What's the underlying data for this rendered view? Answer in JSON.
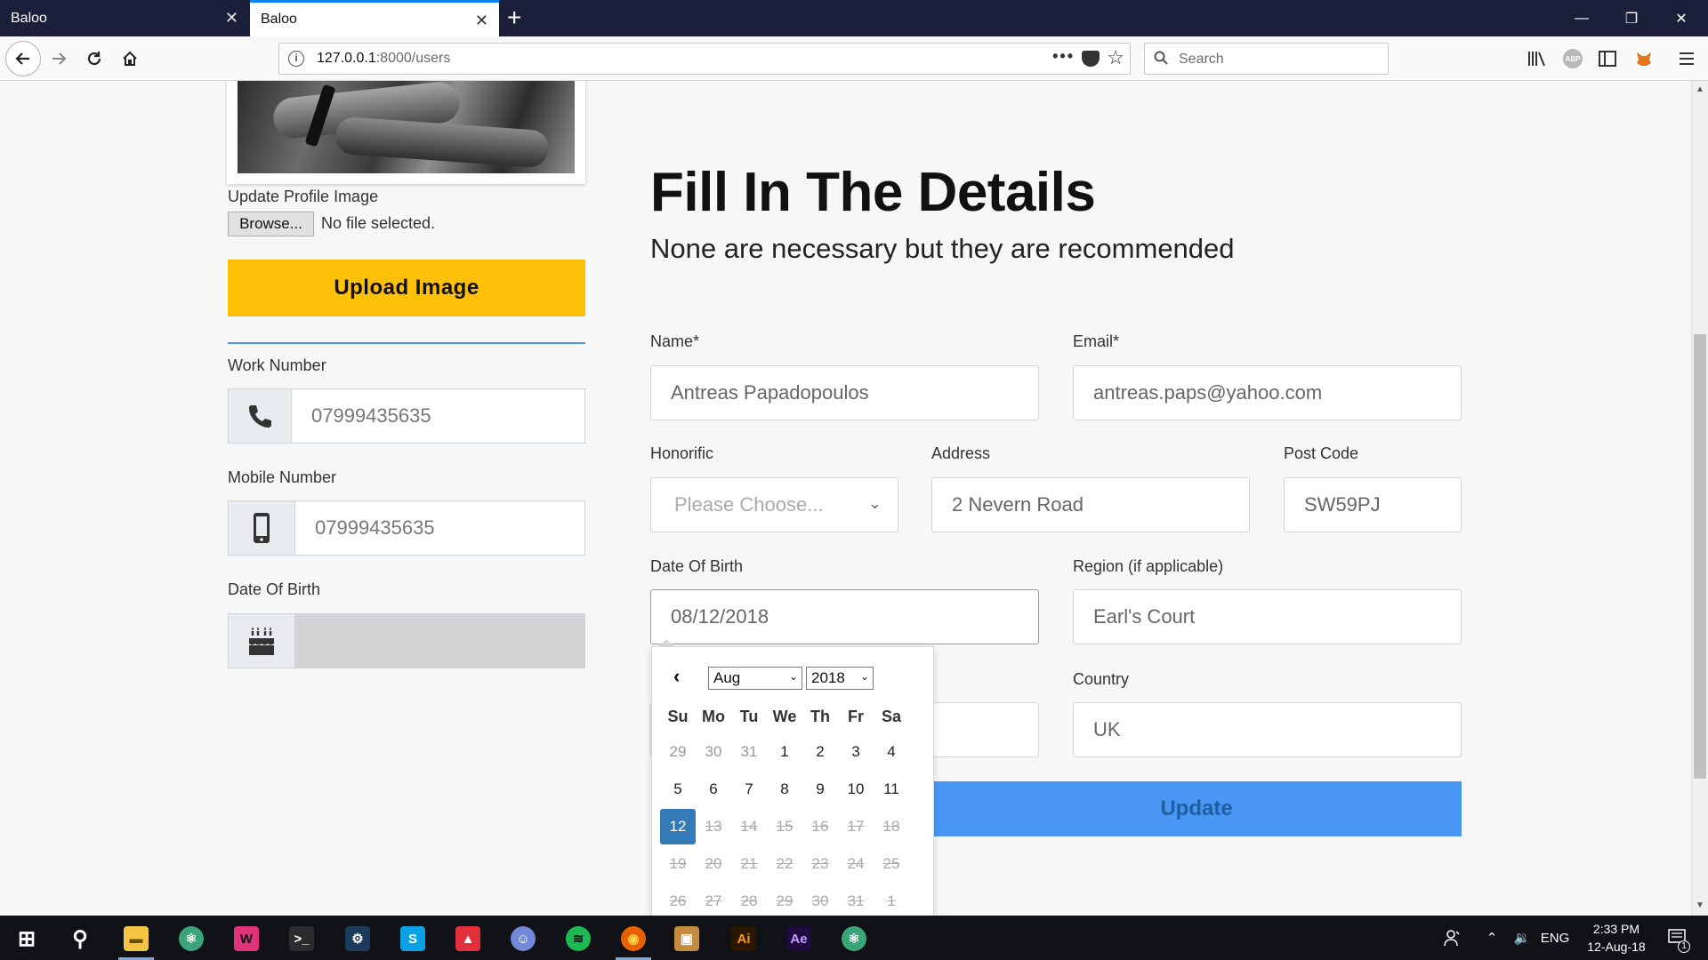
{
  "browser": {
    "tabs": [
      {
        "title": "Baloo",
        "active": false
      },
      {
        "title": "Baloo",
        "active": true
      }
    ],
    "new_tab_glyph": "+",
    "url_host": "127.0.0.1",
    "url_path": ":8000/users",
    "search_placeholder": "Search",
    "page_actions_glyph": "•••",
    "window_controls": [
      "—",
      "❐",
      "✕"
    ]
  },
  "sidebar": {
    "update_profile_label": "Update Profile Image",
    "browse_label": "Browse...",
    "file_status": "No file selected.",
    "upload_label": "Upload Image",
    "work_number_label": "Work Number",
    "work_number": "07999435635",
    "mobile_number_label": "Mobile Number",
    "mobile_number": "07999435635",
    "dob_label": "Date Of Birth",
    "dob_value": ""
  },
  "form": {
    "title": "Fill In The Details",
    "subtitle": "None are necessary but they are recommended",
    "name_label": "Name*",
    "name_value": "Antreas Papadopoulos",
    "email_label": "Email*",
    "email_value": "antreas.paps@yahoo.com",
    "honorific_label": "Honorific",
    "honorific_placeholder": "Please Choose...",
    "address_label": "Address",
    "address_value": "2 Nevern Road",
    "postcode_label": "Post Code",
    "postcode_value": "SW59PJ",
    "dob_label": "Date Of Birth",
    "dob_value": "08/12/2018",
    "region_label": "Region (if applicable)",
    "region_value": "Earl's Court",
    "country_label": "Country",
    "country_value": "UK",
    "update_label": "Update"
  },
  "datepicker": {
    "month": "Aug",
    "year": "2018",
    "weekdays": [
      "Su",
      "Mo",
      "Tu",
      "We",
      "Th",
      "Fr",
      "Sa"
    ],
    "weeks": [
      [
        {
          "d": "29",
          "s": "muted"
        },
        {
          "d": "30",
          "s": "muted"
        },
        {
          "d": "31",
          "s": "muted"
        },
        {
          "d": "1",
          "s": ""
        },
        {
          "d": "2",
          "s": ""
        },
        {
          "d": "3",
          "s": ""
        },
        {
          "d": "4",
          "s": ""
        }
      ],
      [
        {
          "d": "5",
          "s": ""
        },
        {
          "d": "6",
          "s": ""
        },
        {
          "d": "7",
          "s": ""
        },
        {
          "d": "8",
          "s": ""
        },
        {
          "d": "9",
          "s": ""
        },
        {
          "d": "10",
          "s": ""
        },
        {
          "d": "11",
          "s": ""
        }
      ],
      [
        {
          "d": "12",
          "s": "selected"
        },
        {
          "d": "13",
          "s": "disabled"
        },
        {
          "d": "14",
          "s": "disabled"
        },
        {
          "d": "15",
          "s": "disabled"
        },
        {
          "d": "16",
          "s": "disabled"
        },
        {
          "d": "17",
          "s": "disabled"
        },
        {
          "d": "18",
          "s": "disabled"
        }
      ],
      [
        {
          "d": "19",
          "s": "disabled"
        },
        {
          "d": "20",
          "s": "disabled"
        },
        {
          "d": "21",
          "s": "disabled"
        },
        {
          "d": "22",
          "s": "disabled"
        },
        {
          "d": "23",
          "s": "disabled"
        },
        {
          "d": "24",
          "s": "disabled"
        },
        {
          "d": "25",
          "s": "disabled"
        }
      ],
      [
        {
          "d": "26",
          "s": "disabled"
        },
        {
          "d": "27",
          "s": "disabled"
        },
        {
          "d": "28",
          "s": "disabled"
        },
        {
          "d": "29",
          "s": "disabled"
        },
        {
          "d": "30",
          "s": "disabled"
        },
        {
          "d": "31",
          "s": "disabled"
        },
        {
          "d": "1",
          "s": "disabled"
        }
      ]
    ]
  },
  "taskbar": {
    "apps": [
      {
        "name": "start-icon",
        "glyph": "⊞",
        "bg": "transparent",
        "fg": "#ffffff"
      },
      {
        "name": "search-icon",
        "glyph": "⚲",
        "bg": "transparent",
        "fg": "#ffffff"
      },
      {
        "name": "file-explorer-icon",
        "glyph": "▬",
        "bg": "#f4c542",
        "fg": "#6a4f00"
      },
      {
        "name": "atom-icon",
        "glyph": "⚛",
        "bg": "#3aa57a",
        "fg": "#ffffff"
      },
      {
        "name": "webstorm-icon",
        "glyph": "W",
        "bg": "#e0337c",
        "fg": "#111111"
      },
      {
        "name": "terminal-icon",
        "glyph": ">_",
        "bg": "#2b2b2b",
        "fg": "#ffffff"
      },
      {
        "name": "steam-icon",
        "glyph": "⚙",
        "bg": "#1b3a5c",
        "fg": "#ffffff"
      },
      {
        "name": "skype-icon",
        "glyph": "S",
        "bg": "#0aa1e4",
        "fg": "#ffffff"
      },
      {
        "name": "acrobat-icon",
        "glyph": "▲",
        "bg": "#e2303a",
        "fg": "#ffffff"
      },
      {
        "name": "discord-icon",
        "glyph": "☺",
        "bg": "#7289da",
        "fg": "#ffffff"
      },
      {
        "name": "spotify-icon",
        "glyph": "≋",
        "bg": "#1db954",
        "fg": "#111111"
      },
      {
        "name": "firefox-icon",
        "glyph": "◉",
        "bg": "#e66000",
        "fg": "#ffd24a"
      },
      {
        "name": "package-icon",
        "glyph": "▣",
        "bg": "#c58b3e",
        "fg": "#ffffff"
      },
      {
        "name": "illustrator-icon",
        "glyph": "Ai",
        "bg": "#2b1600",
        "fg": "#ff9a00"
      },
      {
        "name": "after-effects-icon",
        "glyph": "Ae",
        "bg": "#1f0a3d",
        "fg": "#c39bff"
      },
      {
        "name": "atom-icon-2",
        "glyph": "⚛",
        "bg": "#3aa57a",
        "fg": "#ffffff"
      }
    ],
    "language": "ENG",
    "time": "2:33 PM",
    "date": "12-Aug-18",
    "notification_count": "1"
  }
}
